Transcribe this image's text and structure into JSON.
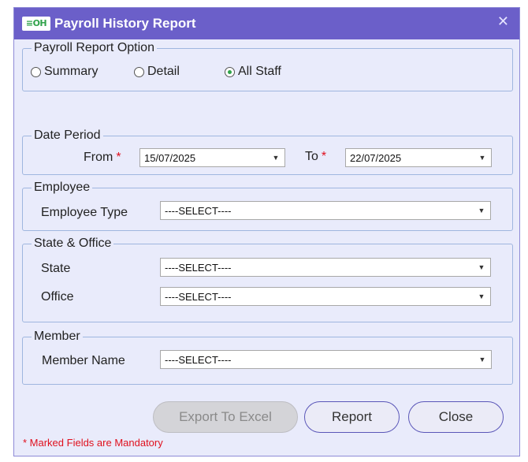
{
  "window": {
    "logo_text": "≡OH",
    "title": "Payroll History Report",
    "close_glyph": "✕"
  },
  "report_option": {
    "legend": "Payroll Report Option",
    "options": [
      {
        "label": "Summary",
        "checked": false
      },
      {
        "label": "Detail",
        "checked": false
      },
      {
        "label": "All Staff",
        "checked": true
      }
    ]
  },
  "date_period": {
    "legend": "Date Period",
    "from_label": "From",
    "from_value": "15/07/2025",
    "to_label": "To",
    "to_value": "22/07/2025",
    "required_mark": "*"
  },
  "employee": {
    "legend": "Employee",
    "type_label": "Employee Type",
    "type_value": "----SELECT----"
  },
  "state_office": {
    "legend": "State & Office",
    "state_label": "State",
    "state_value": "----SELECT----",
    "office_label": "Office",
    "office_value": "----SELECT----"
  },
  "member": {
    "legend": "Member",
    "name_label": "Member Name",
    "name_value": "----SELECT----"
  },
  "buttons": {
    "export": "Export To Excel",
    "report": "Report",
    "close": "Close"
  },
  "footer_note": "* Marked Fields are Mandatory",
  "dropdown_arrow": "▼",
  "colors": {
    "titlebar": "#6b5fc9",
    "background": "#e9ebfb",
    "required": "#e0101e",
    "radio_checked": "#2fa24a"
  }
}
